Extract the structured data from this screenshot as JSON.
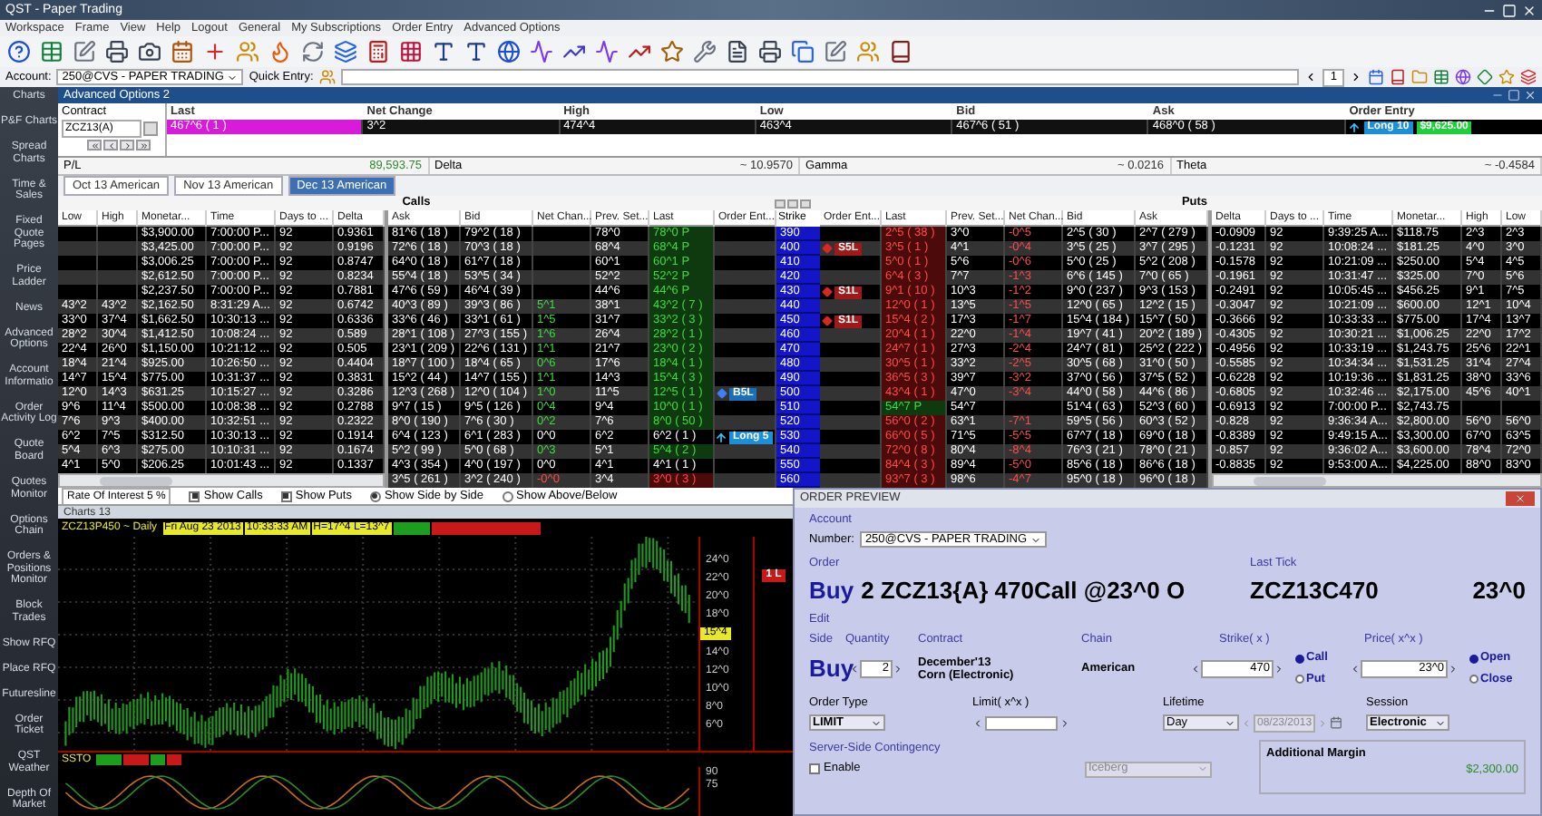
{
  "window": {
    "title": "QST - Paper Trading"
  },
  "menu": [
    "Workspace",
    "Frame",
    "View",
    "Help",
    "Logout",
    "General",
    "My Subscriptions",
    "Order Entry",
    "Advanced Options"
  ],
  "account_bar": {
    "account_label": "Account:",
    "account": "250@CVS - PAPER TRADING",
    "quick_entry_label": "Quick Entry:",
    "quantity": "1"
  },
  "sidebar": [
    "Charts",
    "P&F Charts",
    "Spread Charts",
    "Time & Sales",
    "Fixed Quote Pages",
    "Price Ladder",
    "News",
    "Advanced Options",
    "Account Informatio",
    "Order Activity Log",
    "Quote Board",
    "Quotes Monitor",
    "Options Chain",
    "Orders & Positions Monitor",
    "Block Trades",
    "Show RFQ",
    "Place RFQ",
    "Futuresline",
    "Order Ticket",
    "QST Weather",
    "Depth Of Market"
  ],
  "options_window": {
    "title": "Advanced Options 2",
    "contract": {
      "label": "Contract",
      "value": "ZCZ13(A)"
    },
    "quote": [
      {
        "label": "Last",
        "value": "467^6 ( 1 )",
        "kind": "last"
      },
      {
        "label": "Net Change",
        "value": "3^2",
        "kind": "plain"
      },
      {
        "label": "High",
        "value": "474^4",
        "kind": "plain"
      },
      {
        "label": "Low",
        "value": "463^4",
        "kind": "plain"
      },
      {
        "label": "Bid",
        "value": "467^6 ( 51 )",
        "kind": "plain"
      },
      {
        "label": "Ask",
        "value": "468^0 ( 58 )",
        "kind": "plain"
      },
      {
        "label": "Order Entry",
        "position": "Long 10",
        "pnl": "$9,625.00",
        "kind": "order"
      }
    ],
    "greeks": [
      {
        "label": "P/L",
        "value": "89,593.75",
        "kind": "pnl"
      },
      {
        "label": "Delta",
        "value": "~ 10.9570",
        "kind": "plain"
      },
      {
        "label": "Gamma",
        "value": "~ 0.0216",
        "kind": "plain"
      },
      {
        "label": "Theta",
        "value": "~ -0.4584",
        "kind": "plain"
      }
    ],
    "tabs": [
      {
        "label": "Oct 13 American",
        "selected": false
      },
      {
        "label": "Nov 13 American",
        "selected": false
      },
      {
        "label": "Dec 13 American",
        "selected": true
      }
    ],
    "calls_title": "Calls",
    "puts_title": "Puts",
    "call_columns_left": [
      "Low",
      "High",
      "Monetar...",
      "Time",
      "Days to ...",
      "Delta"
    ],
    "call_columns_right": [
      "Ask",
      "Bid",
      "Net Chan...",
      "Prev. Set...",
      "Last",
      "Order Ent..."
    ],
    "strike_header": "Strike",
    "put_columns_left": [
      "Order Ent...",
      "Last",
      "Prev. Set...",
      "Net Chan...",
      "Bid",
      "Ask"
    ],
    "put_columns_right": [
      "Delta",
      "Days to ...",
      "Time",
      "Monetar...",
      "High",
      "Low"
    ],
    "rows": [
      {
        "strike": "390",
        "call": {
          "monetary": "$3,900.00",
          "time": "7:00:00 P...",
          "days": "92",
          "delta": "0.9361",
          "ask": "81^6 ( 18 )",
          "bid": "79^2 ( 18 )",
          "prev_settle": "78^0",
          "last": "78^0 P",
          "kind": "up"
        },
        "put": {
          "last": "2^5 ( 38 )",
          "prev_settle": "3^0",
          "net_change": "-0^5",
          "bid": "2^5 ( 30 )",
          "ask": "2^7 ( 279 )",
          "delta": "-0.0909",
          "days": "92",
          "time": "9:39:25 A...",
          "monetary": "$118.75",
          "high": "2^3",
          "low": "2^3",
          "kind": "down"
        }
      },
      {
        "strike": "400",
        "call": {
          "monetary": "$3,425.00",
          "time": "7:00:00 P...",
          "days": "92",
          "delta": "0.9196",
          "ask": "72^6 ( 18 )",
          "bid": "70^3 ( 18 )",
          "prev_settle": "68^4",
          "last": "68^4 P",
          "kind": "up"
        },
        "put": {
          "order": {
            "kind": "sell_order",
            "label": "S5L"
          },
          "last": "3^5 ( 1 )",
          "prev_settle": "4^1",
          "net_change": "-0^4",
          "bid": "3^5 ( 25 )",
          "ask": "3^7 ( 295 )",
          "delta": "-0.1231",
          "days": "92",
          "time": "10:08:24 ...",
          "monetary": "$181.25",
          "high": "4^0",
          "low": "3^0",
          "kind": "down"
        }
      },
      {
        "strike": "410",
        "call": {
          "monetary": "$3,006.25",
          "time": "7:00:00 P...",
          "days": "92",
          "delta": "0.8747",
          "ask": "64^0 ( 18 )",
          "bid": "61^7 ( 18 )",
          "prev_settle": "60^1",
          "last": "60^1 P",
          "kind": "up"
        },
        "put": {
          "last": "5^0 ( 1 )",
          "prev_settle": "5^6",
          "net_change": "-0^6",
          "bid": "5^0 ( 25 )",
          "ask": "5^2 ( 208 )",
          "delta": "-0.1578",
          "days": "92",
          "time": "10:21:09 ...",
          "monetary": "$250.00",
          "high": "5^4",
          "low": "4^5",
          "kind": "down"
        }
      },
      {
        "strike": "420",
        "call": {
          "monetary": "$2,612.50",
          "time": "7:00:00 P...",
          "days": "92",
          "delta": "0.8234",
          "ask": "55^4 ( 18 )",
          "bid": "53^5 ( 34 )",
          "prev_settle": "52^2",
          "last": "52^2 P",
          "kind": "up"
        },
        "put": {
          "last": "6^4 ( 3 )",
          "prev_settle": "7^7",
          "net_change": "-1^3",
          "bid": "6^6 ( 145 )",
          "ask": "7^0 ( 65 )",
          "delta": "-0.1961",
          "days": "92",
          "time": "10:31:47 ...",
          "monetary": "$325.00",
          "high": "7^0",
          "low": "5^6",
          "kind": "down"
        }
      },
      {
        "strike": "430",
        "call": {
          "monetary": "$2,237.50",
          "time": "7:00:00 P...",
          "days": "92",
          "delta": "0.7881",
          "ask": "47^6 ( 59 )",
          "bid": "46^4 ( 39 )",
          "prev_settle": "44^6",
          "last": "44^6 P",
          "kind": "up"
        },
        "put": {
          "order": {
            "kind": "sell_order",
            "label": "S1L"
          },
          "last": "9^1 ( 10 )",
          "prev_settle": "10^3",
          "net_change": "-1^2",
          "bid": "9^0 ( 237 )",
          "ask": "9^3 ( 153 )",
          "delta": "-0.2491",
          "days": "92",
          "time": "10:05:45 ...",
          "monetary": "$456.25",
          "high": "9^1",
          "low": "7^5",
          "kind": "down"
        }
      },
      {
        "strike": "440",
        "call": {
          "low": "43^2",
          "high": "43^2",
          "monetary": "$2,162.50",
          "time": "8:31:29 A...",
          "days": "92",
          "delta": "0.6742",
          "ask": "40^3 ( 89 )",
          "bid": "39^3 ( 86 )",
          "net_change": "5^1",
          "prev_settle": "38^1",
          "last": "43^2 ( 7 )",
          "kind": "up"
        },
        "put": {
          "last": "12^0 ( 1 )",
          "prev_settle": "13^5",
          "net_change": "-1^5",
          "bid": "12^0 ( 65 )",
          "ask": "12^2 ( 15 )",
          "delta": "-0.3047",
          "days": "92",
          "time": "10:21:09 ...",
          "monetary": "$600.00",
          "high": "12^1",
          "low": "10^4",
          "kind": "down"
        }
      },
      {
        "strike": "450",
        "call": {
          "low": "33^0",
          "high": "37^4",
          "monetary": "$1,662.50",
          "time": "10:30:13 ...",
          "days": "92",
          "delta": "0.6336",
          "ask": "33^6 ( 46 )",
          "bid": "33^1 ( 61 )",
          "net_change": "1^5",
          "prev_settle": "31^7",
          "last": "33^2 ( 3 )",
          "kind": "up"
        },
        "put": {
          "order": {
            "kind": "sell_order",
            "label": "S1L"
          },
          "last": "15^4 ( 2 )",
          "prev_settle": "17^3",
          "net_change": "-1^7",
          "bid": "15^4 ( 184 )",
          "ask": "15^7 ( 50 )",
          "delta": "-0.3666",
          "days": "92",
          "time": "10:33:33 ...",
          "monetary": "$775.00",
          "high": "17^4",
          "low": "13^7",
          "kind": "down"
        }
      },
      {
        "strike": "460",
        "call": {
          "low": "28^2",
          "high": "30^4",
          "monetary": "$1,412.50",
          "time": "10:08:24 ...",
          "days": "92",
          "delta": "0.589",
          "ask": "28^1 ( 108 )",
          "bid": "27^3 ( 155 )",
          "net_change": "1^6",
          "prev_settle": "26^4",
          "last": "28^2 ( 1 )",
          "kind": "up"
        },
        "put": {
          "last": "20^4 ( 1 )",
          "prev_settle": "22^0",
          "net_change": "-1^4",
          "bid": "19^7 ( 41 )",
          "ask": "20^2 ( 189 )",
          "delta": "-0.4305",
          "days": "92",
          "time": "10:30:21 ...",
          "monetary": "$1,006.25",
          "high": "22^0",
          "low": "17^2",
          "kind": "down"
        }
      },
      {
        "strike": "470",
        "call": {
          "low": "22^4",
          "high": "26^0",
          "monetary": "$1,150.00",
          "time": "10:21:12 ...",
          "days": "92",
          "delta": "0.505",
          "ask": "23^1 ( 209 )",
          "bid": "22^6 ( 131 )",
          "net_change": "1^1",
          "prev_settle": "21^7",
          "last": "23^0 ( 2 )",
          "kind": "up"
        },
        "put": {
          "last": "24^7 ( 1 )",
          "prev_settle": "27^3",
          "net_change": "-2^4",
          "bid": "24^7 ( 81 )",
          "ask": "25^2 ( 222 )",
          "delta": "-0.4956",
          "days": "92",
          "time": "10:33:19 ...",
          "monetary": "$1,243.75",
          "high": "25^6",
          "low": "22^1",
          "kind": "down"
        }
      },
      {
        "strike": "480",
        "call": {
          "low": "18^4",
          "high": "21^4",
          "monetary": "$925.00",
          "time": "10:26:50 ...",
          "days": "92",
          "delta": "0.4404",
          "ask": "18^7 ( 100 )",
          "bid": "18^4 ( 65 )",
          "net_change": "0^6",
          "prev_settle": "17^6",
          "last": "18^4 ( 1 )",
          "kind": "up"
        },
        "put": {
          "last": "30^5 ( 1 )",
          "prev_settle": "33^2",
          "net_change": "-2^5",
          "bid": "30^5 ( 68 )",
          "ask": "31^0 ( 50 )",
          "delta": "-0.5585",
          "days": "92",
          "time": "10:34:34 ...",
          "monetary": "$1,531.25",
          "high": "31^4",
          "low": "27^4",
          "kind": "down"
        }
      },
      {
        "strike": "490",
        "call": {
          "low": "14^7",
          "high": "15^4",
          "monetary": "$775.00",
          "time": "10:31:37 ...",
          "days": "92",
          "delta": "0.3831",
          "ask": "15^2 ( 44 )",
          "bid": "14^7 ( 155 )",
          "net_change": "1^1",
          "prev_settle": "14^3",
          "last": "15^4 ( 3 )",
          "kind": "up"
        },
        "put": {
          "last": "36^5 ( 3 )",
          "prev_settle": "39^7",
          "net_change": "-3^2",
          "bid": "37^0 ( 56 )",
          "ask": "37^5 ( 52 )",
          "delta": "-0.6228",
          "days": "92",
          "time": "10:19:36 ...",
          "monetary": "$1,831.25",
          "high": "38^0",
          "low": "33^6",
          "kind": "down"
        }
      },
      {
        "strike": "500",
        "call": {
          "low": "12^0",
          "high": "14^3",
          "monetary": "$631.25",
          "time": "10:15:27 ...",
          "days": "92",
          "delta": "0.3286",
          "ask": "12^3 ( 268 )",
          "bid": "12^0 ( 104 )",
          "net_change": "1^0",
          "prev_settle": "11^5",
          "last": "12^5 ( 1 )",
          "kind": "up",
          "order": {
            "kind": "buy_order",
            "label": "B5L"
          }
        },
        "put": {
          "last": "43^4 ( 1 )",
          "prev_settle": "47^0",
          "net_change": "-3^4",
          "bid": "44^0 ( 58 )",
          "ask": "44^6 ( 86 )",
          "delta": "-0.6805",
          "days": "92",
          "time": "10:32:46 ...",
          "monetary": "$2,175.00",
          "high": "45^6",
          "low": "40^1",
          "kind": "down"
        }
      },
      {
        "strike": "510",
        "call": {
          "low": "9^6",
          "high": "11^4",
          "monetary": "$500.00",
          "time": "10:08:38 ...",
          "days": "92",
          "delta": "0.2788",
          "ask": "9^7 ( 15 )",
          "bid": "9^5 ( 126 )",
          "net_change": "0^4",
          "prev_settle": "9^4",
          "last": "10^0 ( 1 )",
          "kind": "up"
        },
        "put": {
          "last": "54^7 P",
          "prev_settle": "54^7",
          "bid": "51^4 ( 63 )",
          "ask": "52^3 ( 60 )",
          "delta": "-0.6913",
          "days": "92",
          "time": "7:00:00 P...",
          "monetary": "$2,743.75",
          "kind": "up"
        }
      },
      {
        "strike": "520",
        "call": {
          "low": "7^6",
          "high": "9^3",
          "monetary": "$400.00",
          "time": "10:32:51 ...",
          "days": "92",
          "delta": "0.2322",
          "ask": "8^0 ( 190 )",
          "bid": "7^6 ( 30 )",
          "net_change": "0^2",
          "prev_settle": "7^6",
          "last": "8^0 ( 50 )",
          "kind": "up"
        },
        "put": {
          "last": "56^0 ( 2 )",
          "prev_settle": "63^1",
          "net_change": "-7^1",
          "bid": "59^5 ( 56 )",
          "ask": "60^3 ( 52 )",
          "delta": "-0.828",
          "days": "92",
          "time": "9:36:34 A...",
          "monetary": "$2,800.00",
          "high": "56^0",
          "low": "56^0",
          "kind": "down"
        }
      },
      {
        "strike": "530",
        "call": {
          "low": "6^2",
          "high": "7^5",
          "monetary": "$312.50",
          "time": "10:30:13 ...",
          "days": "92",
          "delta": "0.1914",
          "ask": "6^4 ( 123 )",
          "bid": "6^1 ( 283 )",
          "net_change": "0^0",
          "prev_settle": "6^2",
          "last": "6^2 ( 1 )",
          "kind": "flat",
          "order": {
            "kind": "position",
            "label": "Long 5"
          }
        },
        "put": {
          "last": "66^0 ( 5 )",
          "prev_settle": "71^5",
          "net_change": "-5^5",
          "bid": "67^7 ( 18 )",
          "ask": "69^0 ( 18 )",
          "delta": "-0.8389",
          "days": "92",
          "time": "9:49:15 A...",
          "monetary": "$3,300.00",
          "high": "67^0",
          "low": "63^5",
          "kind": "down"
        }
      },
      {
        "strike": "540",
        "call": {
          "low": "5^4",
          "high": "6^3",
          "monetary": "$275.00",
          "time": "10:10:31 ...",
          "days": "92",
          "delta": "0.1674",
          "ask": "5^2 ( 99 )",
          "bid": "5^0 ( 68 )",
          "net_change": "0^3",
          "prev_settle": "5^1",
          "last": "5^4 ( 2 )",
          "kind": "up"
        },
        "put": {
          "last": "72^0 ( 8 )",
          "prev_settle": "80^4",
          "net_change": "-8^4",
          "bid": "76^3 ( 21 )",
          "ask": "78^0 ( 21 )",
          "delta": "-0.857",
          "days": "92",
          "time": "9:36:02 A...",
          "monetary": "$3,600.00",
          "high": "78^4",
          "low": "72^0",
          "kind": "down"
        }
      },
      {
        "strike": "550",
        "call": {
          "low": "4^1",
          "high": "5^0",
          "monetary": "$206.25",
          "time": "10:01:43 ...",
          "days": "92",
          "delta": "0.1337",
          "ask": "4^3 ( 354 )",
          "bid": "4^0 ( 197 )",
          "net_change": "0^0",
          "prev_settle": "4^1",
          "last": "4^1 ( 1 )",
          "kind": "flat"
        },
        "put": {
          "last": "84^4 ( 3 )",
          "prev_settle": "89^4",
          "net_change": "-5^0",
          "bid": "85^6 ( 18 )",
          "ask": "86^6 ( 18 )",
          "delta": "-0.8835",
          "days": "92",
          "time": "9:53:00 A...",
          "monetary": "$4,225.00",
          "high": "88^0",
          "low": "83^0",
          "kind": "down"
        }
      },
      {
        "strike": "560",
        "call": {
          "ask": "3^5 ( 261 )",
          "bid": "3^2 ( 240 )",
          "net_change": "-0^0",
          "prev_settle": "3^4",
          "last": "3^0 ( 3 )",
          "kind": "down"
        },
        "put": {
          "last": "93^7 ( 3 )",
          "prev_settle": "98^6",
          "net_change": "-4^7",
          "bid": "95^0 ( 18 )",
          "ask": "96^0 ( 18 )",
          "kind": "down"
        }
      }
    ],
    "options_bar": {
      "rate": "Rate Of Interest 5 %",
      "checks": [
        {
          "label": "Show Calls",
          "checked": true
        },
        {
          "label": "Show Puts",
          "checked": true
        }
      ],
      "layouts": [
        {
          "label": "Show Side by Side",
          "selected": true
        },
        {
          "label": "Show Above/Below",
          "selected": false
        }
      ]
    }
  },
  "chart_window": {
    "title": "Charts 13",
    "symbol": "ZCZ13P450 ~ Daily",
    "info_tags": [
      "Fri Aug 23 2013",
      "10:33:33 AM",
      "H=17^4 L=13^7"
    ],
    "axis_labels": [
      {
        "text": "24^0",
        "kind": "tick"
      },
      {
        "text": "22^0",
        "kind": "tick"
      },
      {
        "text": "20^0",
        "kind": "tick"
      },
      {
        "text": "18^0",
        "kind": "tick"
      },
      {
        "text": "15^4",
        "kind": "current"
      },
      {
        "text": "14^0",
        "kind": "tick"
      },
      {
        "text": "12^0",
        "kind": "tick"
      },
      {
        "text": "10^0",
        "kind": "tick"
      },
      {
        "text": "8^0",
        "kind": "tick"
      },
      {
        "text": "6^0",
        "kind": "tick"
      }
    ],
    "position_marker": "1 L",
    "indicator": "SSTO",
    "indicator_axis": [
      "90",
      "75"
    ]
  },
  "order_preview": {
    "title": "ORDER PREVIEW",
    "account_label": "Account",
    "number_label": "Number:",
    "account": "250@CVS - PAPER TRADING",
    "order_label": "Order",
    "order_side": "Buy",
    "order_text": "2 ZCZ13{A} 470Call @23^0 O",
    "last_tick_label": "Last Tick",
    "symbol": "ZCZ13C470",
    "price": "23^0",
    "edit": "Edit",
    "side_label": "Side",
    "quantity_label": "Quantity",
    "contract_label": "Contract",
    "chain_label": "Chain",
    "strike_label": "Strike( x )",
    "price_label": "Price( x^x )",
    "side": "Buy",
    "quantity": "2",
    "contract": [
      "December'13",
      "Corn (Electronic)"
    ],
    "chain": "American",
    "strike": "470",
    "option_types": [
      {
        "label": "Call",
        "selected": true
      },
      {
        "label": "Put",
        "selected": false
      }
    ],
    "limit_price": "23^0",
    "open_close": [
      {
        "label": "Open",
        "selected": true
      },
      {
        "label": "Close",
        "selected": false
      }
    ],
    "order_type_label": "Order Type",
    "order_type": "LIMIT",
    "limit_label": "Limit( x^x )",
    "lifetime_label": "Lifetime",
    "lifetime": "Day",
    "expiry_date": "08/23/2013",
    "session_label": "Session",
    "session": "Electronic",
    "contingency_label": "Server-Side Contingency",
    "enable": {
      "label": "Enable",
      "checked": false
    },
    "contingency_type": "Iceberg",
    "margin_label": "Additional Margin",
    "margin": "$2,300.00"
  }
}
